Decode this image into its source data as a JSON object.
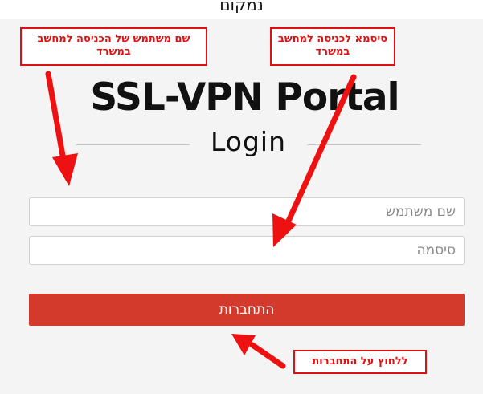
{
  "page": {
    "top_label": "נמקום"
  },
  "login": {
    "title": "SSL-VPN Portal",
    "subtitle": "Login",
    "username_placeholder": "שם משתמש",
    "password_placeholder": "סיסמה",
    "login_button": "התחברות"
  },
  "annotations": {
    "username_note": "שם משתמש של הכניסה למחשב במשרד",
    "password_note": "סיסמא לכניסה למחשב במשרד",
    "login_note": "ללחוץ על התחברות"
  },
  "colors": {
    "accent": "#d43a2b",
    "annotation": "#e01010",
    "panel_background": "#f4f4f4"
  }
}
